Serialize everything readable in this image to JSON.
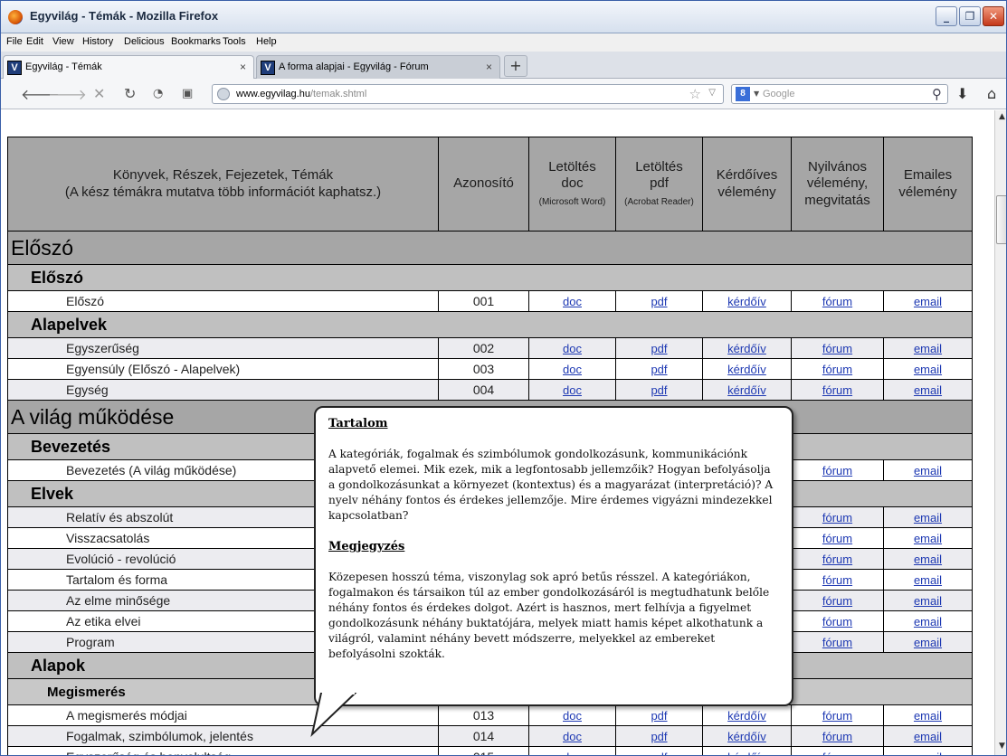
{
  "window": {
    "title": "Egyvilág - Témák - Mozilla Firefox",
    "min_label": "_",
    "max_label": "❐",
    "close_label": "✕"
  },
  "menubar": [
    "File",
    "Edit",
    "View",
    "History",
    "Delicious",
    "Bookmarks",
    "Tools",
    "Help"
  ],
  "tabs": [
    {
      "label": "Egyvilág - Témák",
      "active": true,
      "close": "×"
    },
    {
      "label": "A forma alapjai - Egyvilág - Fórum",
      "active": false,
      "close": "×"
    }
  ],
  "new_tab_label": "+",
  "address": {
    "domain": "www.egyvilag.hu",
    "path": "/temak.shtml"
  },
  "search": {
    "engine_label": "8",
    "placeholder": "Google"
  },
  "table": {
    "headers": {
      "topic_line1": "Könyvek, Részek, Fejezetek, Témák",
      "topic_line2": "(A kész témákra mutatva több információt kaphatsz.)",
      "id": "Azonosító",
      "doc_l1": "Letöltés",
      "doc_l2": "doc",
      "doc_sub": "(Microsoft Word)",
      "pdf_l1": "Letöltés",
      "pdf_l2": "pdf",
      "pdf_sub": "(Acrobat Reader)",
      "survey_l1": "Kérdőíves",
      "survey_l2": "vélemény",
      "forum_l1": "Nyilvános",
      "forum_l2": "vélemény,",
      "forum_l3": "megvitatás",
      "email_l1": "Emailes",
      "email_l2": "vélemény"
    },
    "link_labels": {
      "doc": "doc",
      "pdf": "pdf",
      "survey": "kérdőív",
      "forum": "fórum",
      "email": "email"
    },
    "rows": [
      {
        "type": "part",
        "title": "Előszó"
      },
      {
        "type": "chapter",
        "title": "Előszó"
      },
      {
        "type": "topic",
        "title": "Előszó",
        "id": "001"
      },
      {
        "type": "chapter",
        "title": "Alapelvek"
      },
      {
        "type": "topic",
        "title": "Egyszerűség",
        "id": "002"
      },
      {
        "type": "topic",
        "title": "Egyensúly (Előszó - Alapelvek)",
        "id": "003"
      },
      {
        "type": "topic",
        "title": "Egység",
        "id": "004"
      },
      {
        "type": "part",
        "title": "A világ működése"
      },
      {
        "type": "chapter",
        "title": "Bevezetés"
      },
      {
        "type": "topic",
        "title": "Bevezetés (A világ működése)",
        "id": ""
      },
      {
        "type": "chapter",
        "title": "Elvek"
      },
      {
        "type": "topic",
        "title": "Relatív és abszolút",
        "id": ""
      },
      {
        "type": "topic",
        "title": "Visszacsatolás",
        "id": ""
      },
      {
        "type": "topic",
        "title": "Evolúció - revolúció",
        "id": ""
      },
      {
        "type": "topic",
        "title": "Tartalom és forma",
        "id": ""
      },
      {
        "type": "topic",
        "title": "Az elme minősége",
        "id": ""
      },
      {
        "type": "topic",
        "title": "Az etika elvei",
        "id": ""
      },
      {
        "type": "topic",
        "title": "Program",
        "id": ""
      },
      {
        "type": "chapter",
        "title": "Alapok"
      },
      {
        "type": "section",
        "title": "Megismerés"
      },
      {
        "type": "topic",
        "title": "A megismerés módjai",
        "id": "013"
      },
      {
        "type": "topic",
        "title": "Fogalmak, szimbólumok, jelentés",
        "id": "014"
      },
      {
        "type": "topic",
        "title": "Egyszerűség és bonyolultság",
        "id": "015"
      }
    ]
  },
  "tooltip": {
    "heading1": "Tartalom",
    "text1": "A kategóriák, fogalmak és szimbólumok gondolkozásunk, kommunikációnk alapvető elemei. Mik ezek, mik a legfontosabb jellemzőik? Hogyan befolyásolja a gondolkozásunkat a környezet (kontextus) és a magyarázat (interpretáció)? A nyelv néhány fontos és érdekes jellemzője. Mire érdemes vigyázni mindezekkel kapcsolatban?",
    "heading2": "Megjegyzés",
    "text2": "Közepesen hosszú téma, viszonylag sok apró betűs résszel. A kategóriákon, fogalmakon és társaikon túl az ember gondolkozásáról is megtudhatunk belőle néhány fontos és érdekes dolgot. Azért is hasznos, mert felhívja a figyelmet gondolkozásunk néhány buktatójára, melyek miatt hamis képet alkothatunk a világról, valamint néhány bevett módszerre, melyekkel az embereket befolyásolni szokták."
  },
  "colors": {
    "header_bg": "#a6a6a6",
    "link": "#1e39b3",
    "title_bar": "#d6e0ee"
  }
}
